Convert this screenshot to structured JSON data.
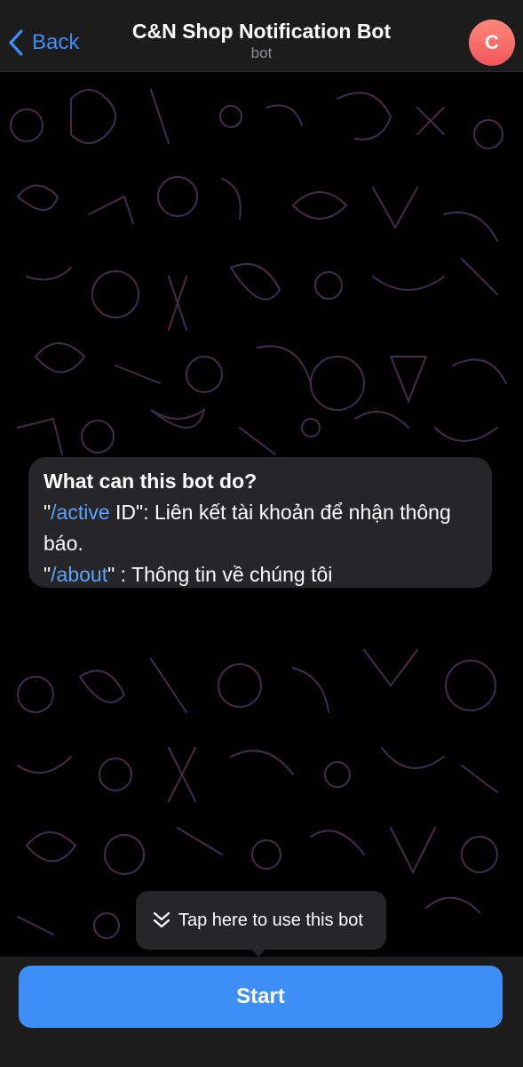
{
  "header": {
    "back_label": "Back",
    "title": "C&N Shop Notification Bot",
    "subtitle": "bot",
    "avatar_initial": "C"
  },
  "info_card": {
    "heading": "What can this bot do?",
    "line1": {
      "quote_open": "\"",
      "command": "/active",
      "rest": " ID\": Liên kết tài khoản để nhận thông báo."
    },
    "line2": {
      "quote_open": "\"",
      "command": "/about",
      "rest": "\" : Thông tin về chúng tôi"
    }
  },
  "tip": {
    "label": "Tap here to use this bot",
    "icon": "double-chevron-down-icon"
  },
  "start_button": {
    "label": "Start"
  },
  "colors": {
    "accent": "#3e8ef7",
    "command_link": "#5ea2f8",
    "avatar_gradient": [
      "#ff8a7a",
      "#f2545b"
    ]
  }
}
